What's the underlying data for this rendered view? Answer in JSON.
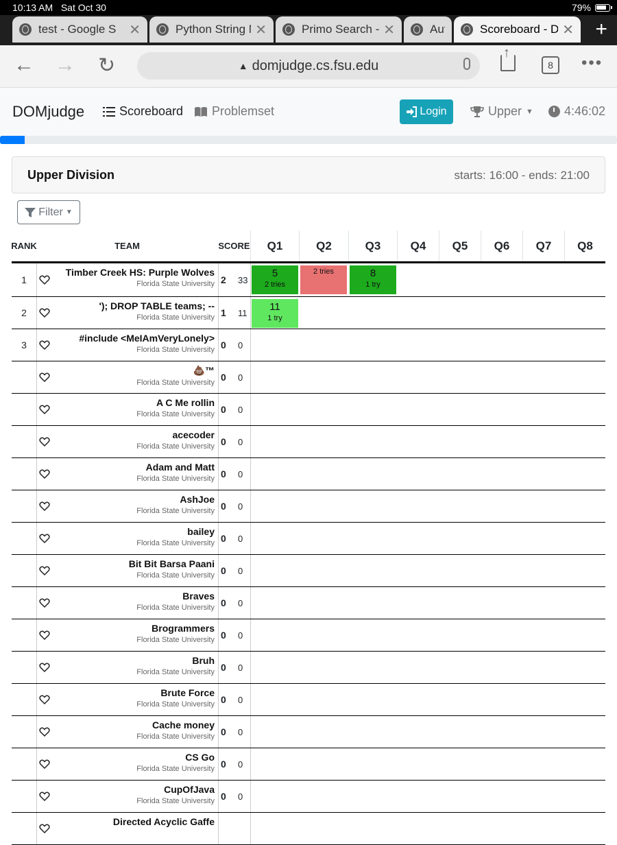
{
  "status": {
    "time": "10:13 AM",
    "date": "Sat Oct 30",
    "battery": "79%"
  },
  "tabs": [
    {
      "title": "test - Google S",
      "active": false
    },
    {
      "title": "Python String M",
      "active": false
    },
    {
      "title": "Primo Search -",
      "active": false
    },
    {
      "title": "Auto",
      "active": false
    },
    {
      "title": "Scoreboard - D",
      "active": true
    }
  ],
  "address": {
    "url": "domjudge.cs.fsu.edu",
    "tab_count": "8"
  },
  "nav": {
    "brand": "DOMjudge",
    "scoreboard": "Scoreboard",
    "problemset": "Problemset",
    "login": "Login",
    "division": "Upper",
    "clock": "4:46:02",
    "progress_percent": 4
  },
  "contest": {
    "title": "Upper Division",
    "times": "starts: 16:00 - ends: 21:00"
  },
  "filter_label": "Filter",
  "headers": {
    "rank": "RANK",
    "team": "TEAM",
    "score": "SCORE",
    "problems": [
      "Q1",
      "Q2",
      "Q3",
      "Q4",
      "Q5",
      "Q6",
      "Q7",
      "Q8"
    ]
  },
  "colors": {
    "first_solve": "#1daa1d",
    "correct": "#60e760",
    "incorrect": "#e87272",
    "accent": "#17a2b8"
  },
  "rows": [
    {
      "rank": "1",
      "name": "Timber Creek HS: Purple Wolves",
      "aff": "Florida State University",
      "solved": "2",
      "points": "33",
      "cells": [
        {
          "q": 0,
          "time": "5",
          "tries": "2 tries",
          "status": "first-solve"
        },
        {
          "q": 1,
          "time": "",
          "tries": "2 tries",
          "status": "incorrect"
        },
        {
          "q": 2,
          "time": "8",
          "tries": "1 try",
          "status": "first-solve"
        }
      ]
    },
    {
      "rank": "2",
      "name": "'); DROP TABLE teams; --",
      "aff": "Florida State University",
      "solved": "1",
      "points": "11",
      "cells": [
        {
          "q": 0,
          "time": "11",
          "tries": "1 try",
          "status": "correct"
        }
      ]
    },
    {
      "rank": "3",
      "name": "#include <MeIAmVeryLonely>",
      "aff": "Florida State University",
      "solved": "0",
      "points": "0",
      "cells": []
    },
    {
      "rank": "",
      "name": "💩™",
      "aff": "Florida State University",
      "solved": "0",
      "points": "0",
      "cells": []
    },
    {
      "rank": "",
      "name": "A C Me rollin",
      "aff": "Florida State University",
      "solved": "0",
      "points": "0",
      "cells": []
    },
    {
      "rank": "",
      "name": "acecoder",
      "aff": "Florida State University",
      "solved": "0",
      "points": "0",
      "cells": []
    },
    {
      "rank": "",
      "name": "Adam and Matt",
      "aff": "Florida State University",
      "solved": "0",
      "points": "0",
      "cells": []
    },
    {
      "rank": "",
      "name": "AshJoe",
      "aff": "Florida State University",
      "solved": "0",
      "points": "0",
      "cells": []
    },
    {
      "rank": "",
      "name": "bailey",
      "aff": "Florida State University",
      "solved": "0",
      "points": "0",
      "cells": []
    },
    {
      "rank": "",
      "name": "Bit Bit Barsa Paani",
      "aff": "Florida State University",
      "solved": "0",
      "points": "0",
      "cells": []
    },
    {
      "rank": "",
      "name": "Braves",
      "aff": "Florida State University",
      "solved": "0",
      "points": "0",
      "cells": []
    },
    {
      "rank": "",
      "name": "Brogrammers",
      "aff": "Florida State University",
      "solved": "0",
      "points": "0",
      "cells": []
    },
    {
      "rank": "",
      "name": "Bruh",
      "aff": "Florida State University",
      "solved": "0",
      "points": "0",
      "cells": []
    },
    {
      "rank": "",
      "name": "Brute Force",
      "aff": "Florida State University",
      "solved": "0",
      "points": "0",
      "cells": []
    },
    {
      "rank": "",
      "name": "Cache money",
      "aff": "Florida State University",
      "solved": "0",
      "points": "0",
      "cells": []
    },
    {
      "rank": "",
      "name": "CS Go",
      "aff": "Florida State University",
      "solved": "0",
      "points": "0",
      "cells": []
    },
    {
      "rank": "",
      "name": "CupOfJava",
      "aff": "Florida State University",
      "solved": "0",
      "points": "0",
      "cells": []
    },
    {
      "rank": "",
      "name": "Directed Acyclic Gaffe",
      "aff": "",
      "solved": "",
      "points": "",
      "cells": []
    }
  ]
}
